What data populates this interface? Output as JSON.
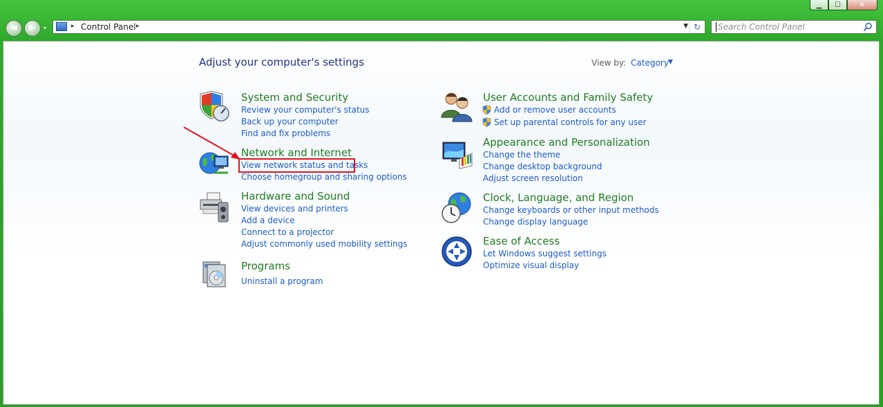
{
  "window": {
    "caption": {
      "minimize": "▁",
      "maximize": "☐",
      "close": "✕"
    }
  },
  "nav": {
    "back": "◄",
    "forward": "►",
    "history": "▾"
  },
  "address": {
    "sep1": "▸",
    "crumb": "Control Panel",
    "sep2": "▸",
    "dropdown": "▼",
    "refresh": "↻"
  },
  "search": {
    "placeholder": "Search Control Panel"
  },
  "main": {
    "heading": "Adjust your computer's settings",
    "view_by_label": "View by:",
    "view_by_value": "Category",
    "view_by_caret": "▼"
  },
  "categories": [
    {
      "title": "System and Security",
      "icon": "shield-gauge-icon",
      "links": [
        "Review your computer's status",
        "Back up your computer",
        "Find and fix problems"
      ]
    },
    {
      "title": "Network and Internet",
      "icon": "globe-network-icon",
      "links": [
        "View network status and tasks",
        "Choose homegroup and sharing options"
      ]
    },
    {
      "title": "Hardware and Sound",
      "icon": "printer-speaker-icon",
      "links": [
        "View devices and printers",
        "Add a device",
        "Connect to a projector",
        "Adjust commonly used mobility settings"
      ]
    },
    {
      "title": "Programs",
      "icon": "programs-disc-icon",
      "links": [
        "Uninstall a program"
      ]
    },
    {
      "title": "User Accounts and Family Safety",
      "icon": "users-icon",
      "links": [
        "Add or remove user accounts",
        "Set up parental controls for any user"
      ]
    },
    {
      "title": "Appearance and Personalization",
      "icon": "monitor-palette-icon",
      "links": [
        "Change the theme",
        "Change desktop background",
        "Adjust screen resolution"
      ]
    },
    {
      "title": "Clock, Language, and Region",
      "icon": "clock-globe-icon",
      "links": [
        "Change keyboards or other input methods",
        "Change display language"
      ]
    },
    {
      "title": "Ease of Access",
      "icon": "ease-of-access-icon",
      "links": [
        "Let Windows suggest settings",
        "Optimize visual display"
      ]
    }
  ],
  "colors": {
    "frame": "#2ea82a",
    "title_green": "#207c1f",
    "link_blue": "#1e5bc6",
    "heading_blue": "#1e3287",
    "annotation_red": "#e3121c"
  }
}
